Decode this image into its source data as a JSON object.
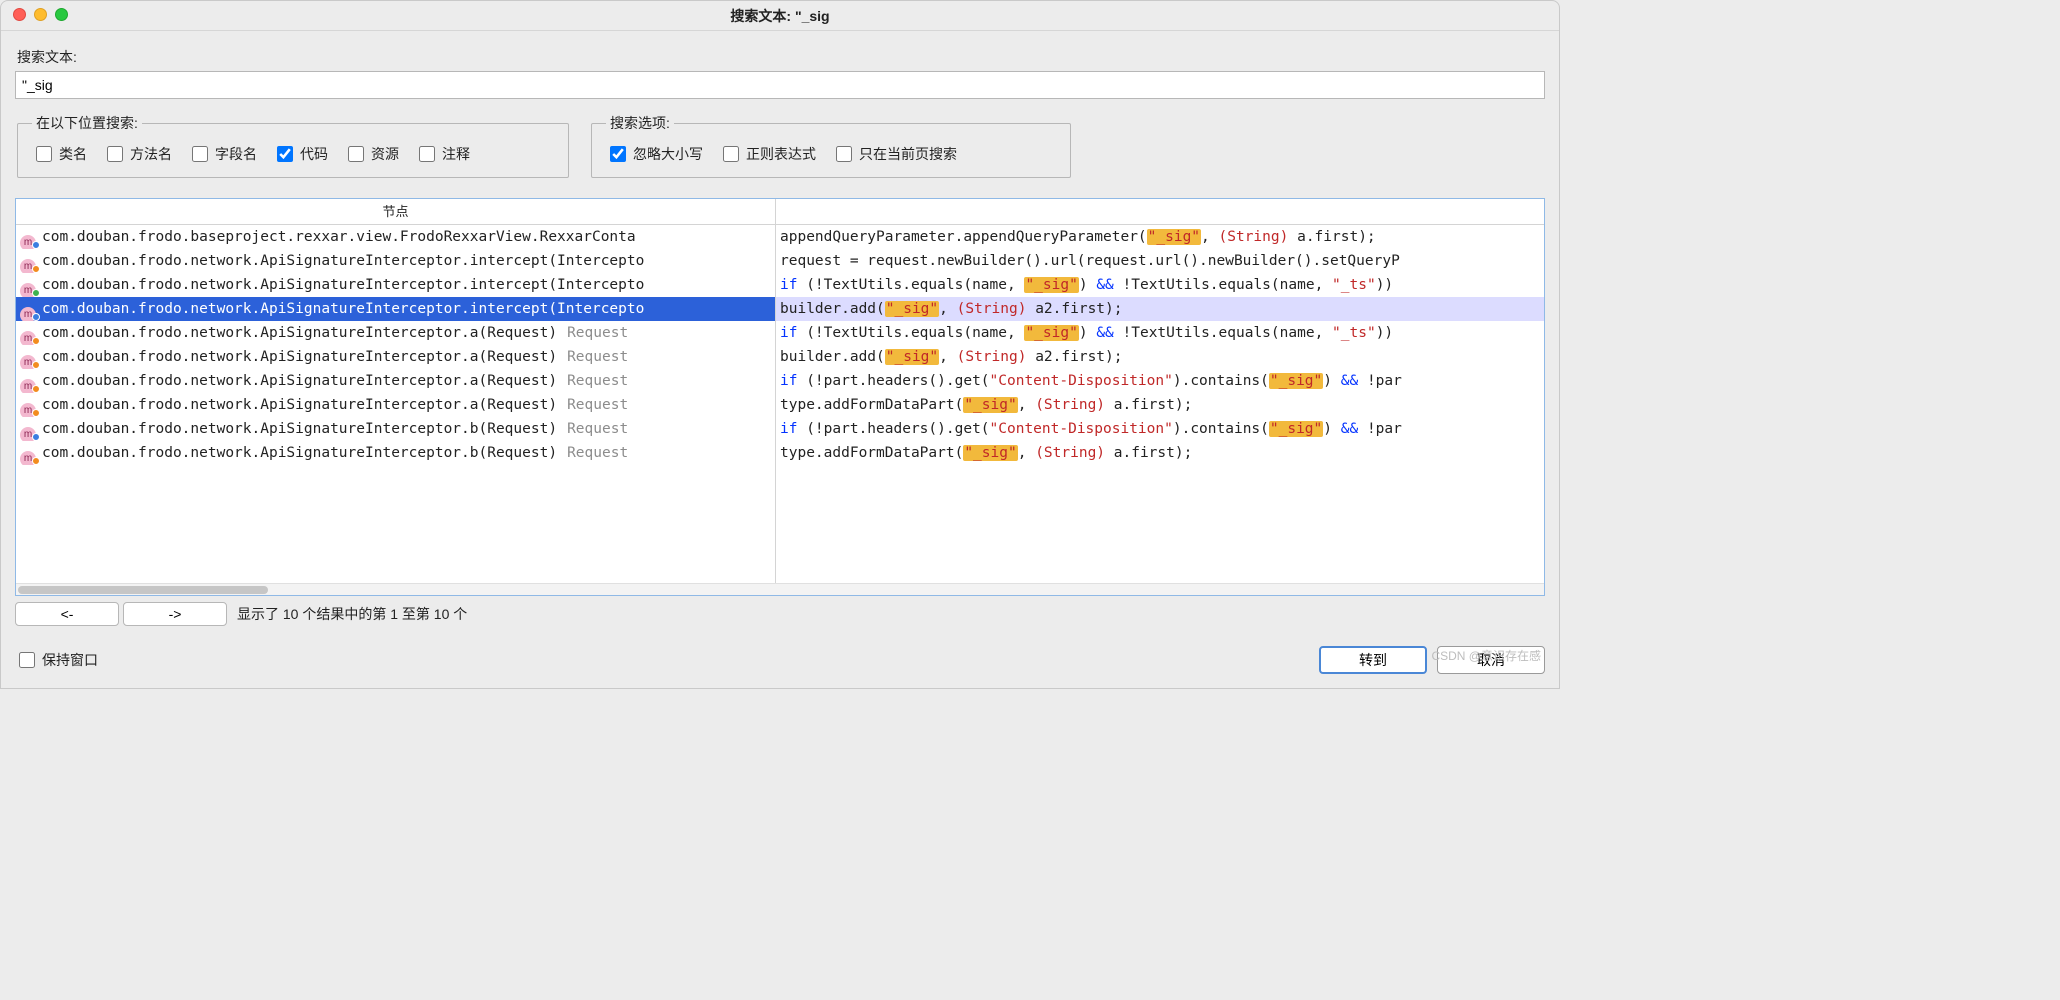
{
  "window": {
    "title": "搜索文本: \"_sig"
  },
  "search": {
    "label": "搜索文本:",
    "value": "\"_sig"
  },
  "scope": {
    "legend": "在以下位置搜索:",
    "items": [
      {
        "label": "类名",
        "checked": false
      },
      {
        "label": "方法名",
        "checked": false
      },
      {
        "label": "字段名",
        "checked": false
      },
      {
        "label": "代码",
        "checked": true
      },
      {
        "label": "资源",
        "checked": false
      },
      {
        "label": "注释",
        "checked": false
      }
    ]
  },
  "options": {
    "legend": "搜索选项:",
    "items": [
      {
        "label": "忽略大小写",
        "checked": true
      },
      {
        "label": "正则表达式",
        "checked": false
      },
      {
        "label": "只在当前页搜索",
        "checked": false
      }
    ]
  },
  "results": {
    "header_left": "节点",
    "selected_index": 3,
    "rows": [
      {
        "dot": "blue",
        "path": "com.douban.frodo.baseproject.rexxar.view.FrodoRexxarView.RexxarConta",
        "ret": ""
      },
      {
        "dot": "orange",
        "path": "com.douban.frodo.network.ApiSignatureInterceptor.intercept(Intercepto",
        "ret": ""
      },
      {
        "dot": "green",
        "path": "com.douban.frodo.network.ApiSignatureInterceptor.intercept(Intercepto",
        "ret": ""
      },
      {
        "dot": "blue",
        "path": "com.douban.frodo.network.ApiSignatureInterceptor.intercept(Intercepto",
        "ret": ""
      },
      {
        "dot": "orange",
        "path": "com.douban.frodo.network.ApiSignatureInterceptor.a(Request)",
        "ret": "Request"
      },
      {
        "dot": "orange",
        "path": "com.douban.frodo.network.ApiSignatureInterceptor.a(Request)",
        "ret": "Request"
      },
      {
        "dot": "orange",
        "path": "com.douban.frodo.network.ApiSignatureInterceptor.a(Request)",
        "ret": "Request"
      },
      {
        "dot": "orange",
        "path": "com.douban.frodo.network.ApiSignatureInterceptor.a(Request)",
        "ret": "Request"
      },
      {
        "dot": "blue",
        "path": "com.douban.frodo.network.ApiSignatureInterceptor.b(Request)",
        "ret": "Request"
      },
      {
        "dot": "orange",
        "path": "com.douban.frodo.network.ApiSignatureInterceptor.b(Request)",
        "ret": "Request"
      }
    ],
    "code": [
      "appendQueryParameter.appendQueryParameter(§\"_sig\"§, ¤(String)¤ a.first);",
      "request = request.newBuilder().url(request.url().newBuilder().setQueryP",
      "~if~ (!TextUtils.equals(name, §\"_sig\"§) && !TextUtils.equals(name, ¤\"_ts\"¤)) ",
      "builder.add(§\"_sig\"§, ¤(String)¤ a2.first);",
      "~if~ (!TextUtils.equals(name, §\"_sig\"§) && !TextUtils.equals(name, ¤\"_ts\"¤)) ",
      "builder.add(§\"_sig\"§, ¤(String)¤ a2.first);",
      "~if~ (!part.headers().get(¤\"Content-Disposition\"¤).contains(§\"_sig\"§) && !par",
      "type.addFormDataPart(§\"_sig\"§, ¤(String)¤ a.first);",
      "~if~ (!part.headers().get(¤\"Content-Disposition\"¤).contains(§\"_sig\"§) && !par",
      "type.addFormDataPart(§\"_sig\"§, ¤(String)¤ a.first);"
    ]
  },
  "pager": {
    "prev": "<-",
    "next": "->",
    "text": "显示了 10 个结果中的第 1 至第 10 个"
  },
  "footer": {
    "keep_window": "保持窗口",
    "goto": "转到",
    "cancel": "取消"
  },
  "watermark": "CSDN @意识存在感"
}
